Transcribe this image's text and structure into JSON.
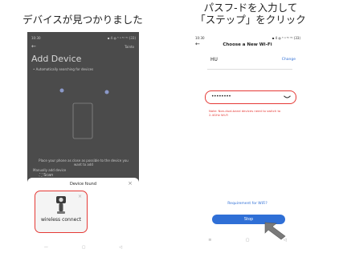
{
  "captions": {
    "left": "デバイスが見つかりました",
    "right_line1": "パスフ-ドを入力して",
    "right_line2": "「ステップ」をクリック"
  },
  "phone_left": {
    "status_time": "10:30",
    "status_right": "▪ 4 ◍ ⁵ ᵍ  ⁵ᵃ ⁸ᵃ (33)",
    "back_arrow": "←",
    "top_right_link": "Tainto",
    "title": "Add Device",
    "subtitle": "•  Automatically searching for devices",
    "hint": "Place your phone as close as possible to the device you want to add",
    "manual_label": "Manually add device",
    "scan_label": "Scan",
    "dialog_title": "Device found",
    "dialog_close": "×",
    "device_name": "wireless connect",
    "nav_icons": [
      "—",
      "▢",
      "◁"
    ]
  },
  "phone_right": {
    "status_time": "10:30",
    "status_right": "▪ 4 ◍ ⁵ ᵍ  ⁵ᵃ ⁸ᵃ (33)",
    "back_arrow": "←",
    "title": "Choose a New Wi-Fi",
    "ssid": "HU",
    "change_link": "Change",
    "password_value": "••••••••",
    "warning": "Note: Non-dual-band devices need to switch to 2.4GHz Wi-Fi",
    "requirement_link": "Requirement for WiFi?",
    "next_button": "Stop",
    "nav_icons": [
      "≡",
      "▢",
      "◁"
    ]
  },
  "colors": {
    "highlight": "#e53935",
    "primary": "#2f6fd6",
    "dark_bg": "#4b4b4b"
  }
}
